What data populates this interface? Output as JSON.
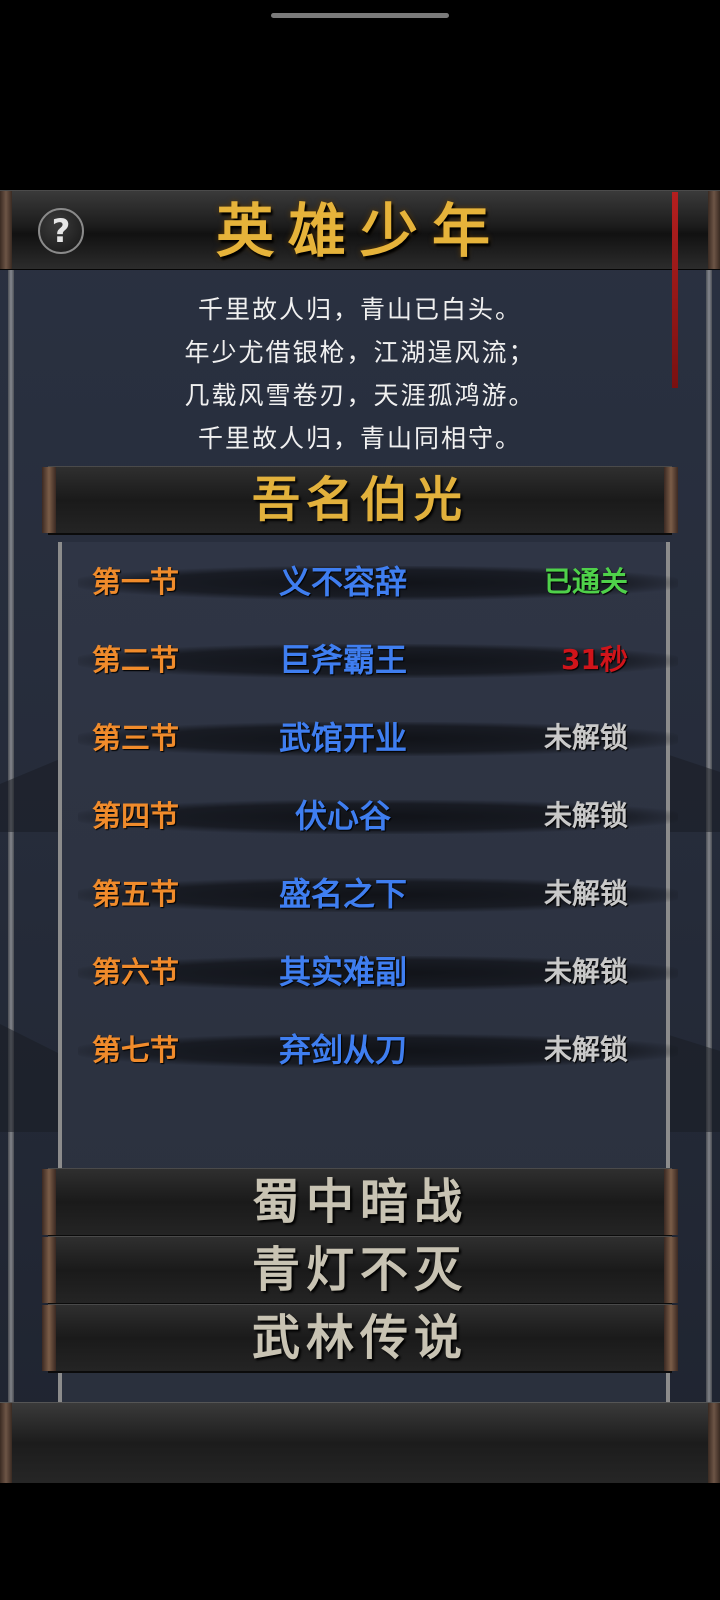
{
  "header": {
    "title": "英雄少年",
    "help_label": "?"
  },
  "poem": {
    "lines": [
      "千里故人归，青山已白头。",
      "年少尤借银枪，江湖逞风流；",
      "几载风雪卷刃，天涯孤鸿游。",
      "千里故人归，青山同相守。"
    ]
  },
  "chapters": {
    "active": {
      "title": "吾名伯光"
    },
    "locked": [
      {
        "title": "蜀中暗战"
      },
      {
        "title": "青灯不灭"
      },
      {
        "title": "武林传说"
      }
    ]
  },
  "levels": [
    {
      "number": "第一节",
      "name": "义不容辞",
      "status": "已通关",
      "status_color": "#4fd14a"
    },
    {
      "number": "第二节",
      "name": "巨斧霸王",
      "status": "31秒",
      "status_color": "#d0141a"
    },
    {
      "number": "第三节",
      "name": "武馆开业",
      "status": "未解锁",
      "status_color": "#c9c9c9"
    },
    {
      "number": "第四节",
      "name": "伏心谷",
      "status": "未解锁",
      "status_color": "#c9c9c9"
    },
    {
      "number": "第五节",
      "name": "盛名之下",
      "status": "未解锁",
      "status_color": "#c9c9c9"
    },
    {
      "number": "第六节",
      "name": "其实难副",
      "status": "未解锁",
      "status_color": "#c9c9c9"
    },
    {
      "number": "第七节",
      "name": "弃剑从刀",
      "status": "未解锁",
      "status_color": "#c9c9c9"
    }
  ],
  "colors": {
    "title_gold": "#e6b33a",
    "level_number": "#f08b2b",
    "level_name": "#3f7ef0",
    "cleared": "#4fd14a",
    "timer": "#d0141a",
    "locked": "#c9c9c9"
  }
}
